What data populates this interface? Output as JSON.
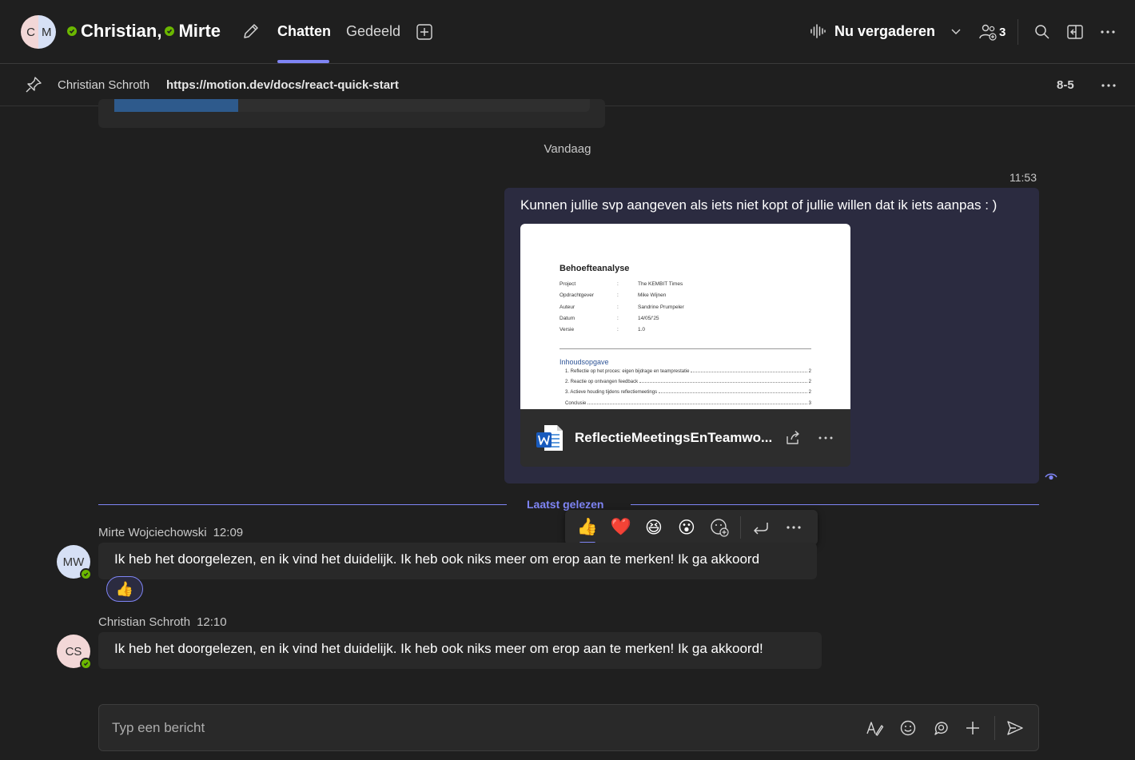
{
  "header": {
    "avatar_initials_left": "C",
    "avatar_initials_right": "M",
    "participant_1": "Christian",
    "separator": ",",
    "participant_2": "Mirte",
    "tabs": [
      {
        "label": "Chatten",
        "active": true
      },
      {
        "label": "Gedeeld",
        "active": false
      }
    ],
    "meet_label": "Nu vergaderen",
    "participant_count": "3"
  },
  "pinned": {
    "author": "Christian Schroth",
    "link": "https://motion.dev/docs/react-quick-start",
    "count": "8-5"
  },
  "chat": {
    "date_divider": "Vandaag",
    "my_message": {
      "time": "11:53",
      "text": "Kunnen jullie svp aangeven als iets niet kopt of jullie willen dat ik iets aanpas : )",
      "file": {
        "name": "ReflectieMeetingsEnTeamwo...",
        "preview": {
          "title": "Behoefteanalyse",
          "rows": [
            {
              "key": "Project",
              "value": "The KEMBIT Times"
            },
            {
              "key": "Opdrachtgever",
              "value": "Mike Wijnen"
            },
            {
              "key": "Auteur",
              "value": "Sandrine Prumpeler"
            },
            {
              "key": "Datum",
              "value": "14/05/'25"
            },
            {
              "key": "Versie",
              "value": "1.0"
            }
          ],
          "toc_title": "Inhoudsopgave",
          "toc": [
            {
              "label": "1. Reflectie op het proces: eigen bijdrage en teamprestatie",
              "page": "2"
            },
            {
              "label": "2. Reactie op ontvangen feedback",
              "page": "2"
            },
            {
              "label": "3. Actieve houding tijdens reflectiemeetings",
              "page": "2"
            },
            {
              "label": "Conclusie",
              "page": "3"
            }
          ]
        }
      }
    },
    "last_read_label": "Laatst gelezen",
    "reactions_bar": [
      "👍",
      "❤️",
      "😆",
      "😮"
    ],
    "messages": [
      {
        "author": "Mirte Wojciechowski",
        "time": "12:09",
        "initials": "MW",
        "text": "Ik heb het doorgelezen, en ik vind het duidelijk. Ik heb ook niks meer om erop aan te merken! Ik ga akkoord",
        "reaction": "👍"
      },
      {
        "author": "Christian Schroth",
        "time": "12:10",
        "initials": "CS",
        "text": "Ik heb het doorgelezen, en ik vind het duidelijk. Ik heb ook niks meer om erop aan te merken! Ik ga akkoord!"
      }
    ]
  },
  "compose": {
    "placeholder": "Typ een bericht"
  },
  "colors": {
    "accent": "#7f85f5",
    "presence": "#6bb700",
    "background": "#1f1f1f",
    "my_bubble": "#2b2b40",
    "other_bubble": "#292929"
  }
}
